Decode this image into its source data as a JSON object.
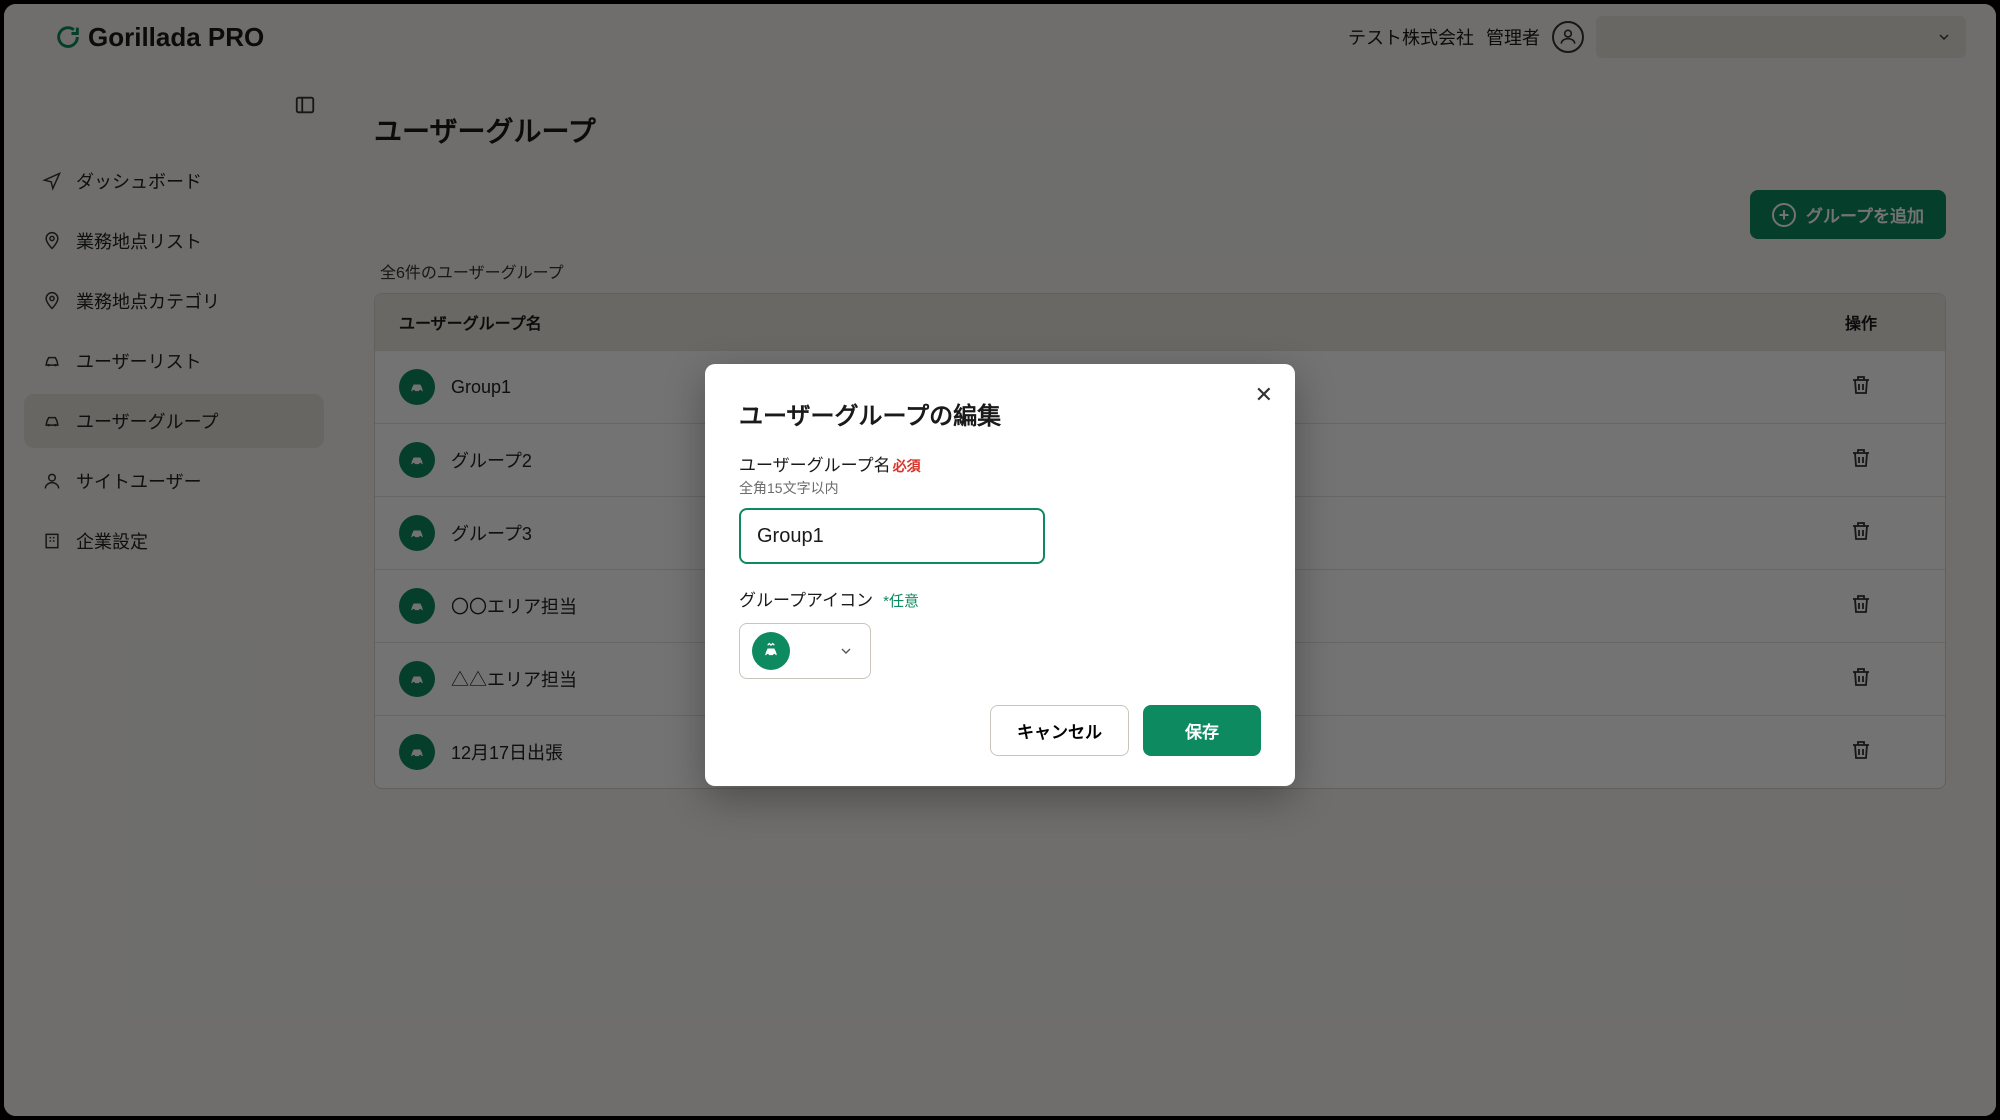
{
  "header": {
    "logo_text": "Gorillada PRO",
    "company": "テスト株式会社",
    "role": "管理者"
  },
  "sidebar": {
    "items": [
      {
        "label": "ダッシュボード"
      },
      {
        "label": "業務地点リスト"
      },
      {
        "label": "業務地点カテゴリ"
      },
      {
        "label": "ユーザーリスト"
      },
      {
        "label": "ユーザーグループ"
      },
      {
        "label": "サイトユーザー"
      },
      {
        "label": "企業設定"
      }
    ]
  },
  "page": {
    "title": "ユーザーグループ",
    "add_button": "グループを追加",
    "count_label": "全6件のユーザーグループ",
    "th_name": "ユーザーグループ名",
    "th_ops": "操作"
  },
  "groups": [
    {
      "name": "Group1"
    },
    {
      "name": "グループ2"
    },
    {
      "name": "グループ3"
    },
    {
      "name": "〇〇エリア担当"
    },
    {
      "name": "△△エリア担当"
    },
    {
      "name": "12月17日出張"
    }
  ],
  "modal": {
    "title": "ユーザーグループの編集",
    "name_label": "ユーザーグループ名",
    "required": "必須",
    "name_hint": "全角15文字以内",
    "name_value": "Group1",
    "icon_label": "グループアイコン",
    "optional": "*任意",
    "cancel": "キャンセル",
    "save": "保存"
  }
}
